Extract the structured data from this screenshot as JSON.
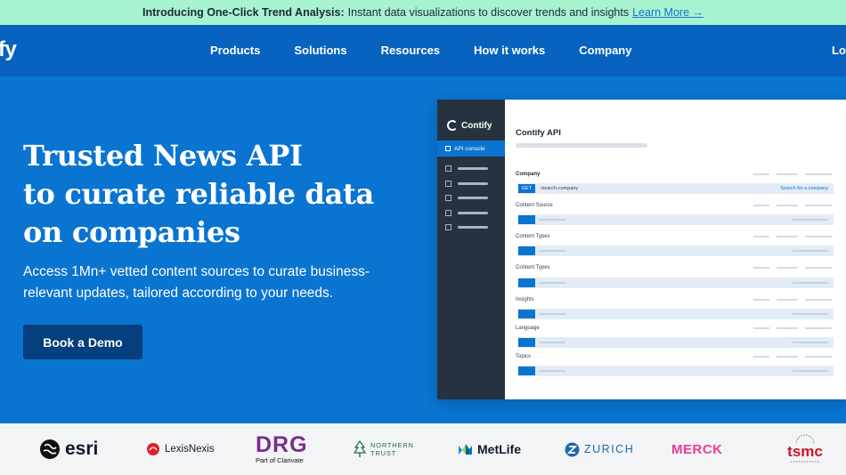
{
  "announcement": {
    "title": "Introducing One-Click Trend Analysis:",
    "text": "Instant data visualizations to discover trends and insights",
    "link": "Learn More →"
  },
  "nav": {
    "brand": "fy",
    "items": [
      "Products",
      "Solutions",
      "Resources",
      "How it works",
      "Company"
    ],
    "login": "Lo"
  },
  "hero": {
    "headline_line1": "Trusted News API",
    "headline_line2": "to curate reliable data",
    "headline_line3": "on companies",
    "subtitle": "Access 1Mn+ vetted content sources to curate business-relevant updates, tailored according to your needs.",
    "cta": "Book a Demo"
  },
  "console": {
    "logo": "Contify",
    "active_item": "API console",
    "title": "Contify API",
    "sections": [
      "Company",
      "Content Source",
      "Content Types",
      "Content Types",
      "Insights",
      "Language",
      "Topics"
    ],
    "method": "GET",
    "endpoint": "/search-company",
    "action": "Search for a company"
  },
  "logos": [
    "esri",
    "LexisNexis",
    "DRG",
    "Part of Clarivate",
    "NORTHERN",
    "TRUST",
    "MetLife",
    "ZURICH",
    "MERCK",
    "tsmc"
  ],
  "colors": {
    "announce_bg": "#a7f3d0",
    "nav_bg": "#0862bf",
    "hero_bg": "#0a74d1",
    "cta_bg": "#063f7d",
    "console_side": "#26323f"
  }
}
